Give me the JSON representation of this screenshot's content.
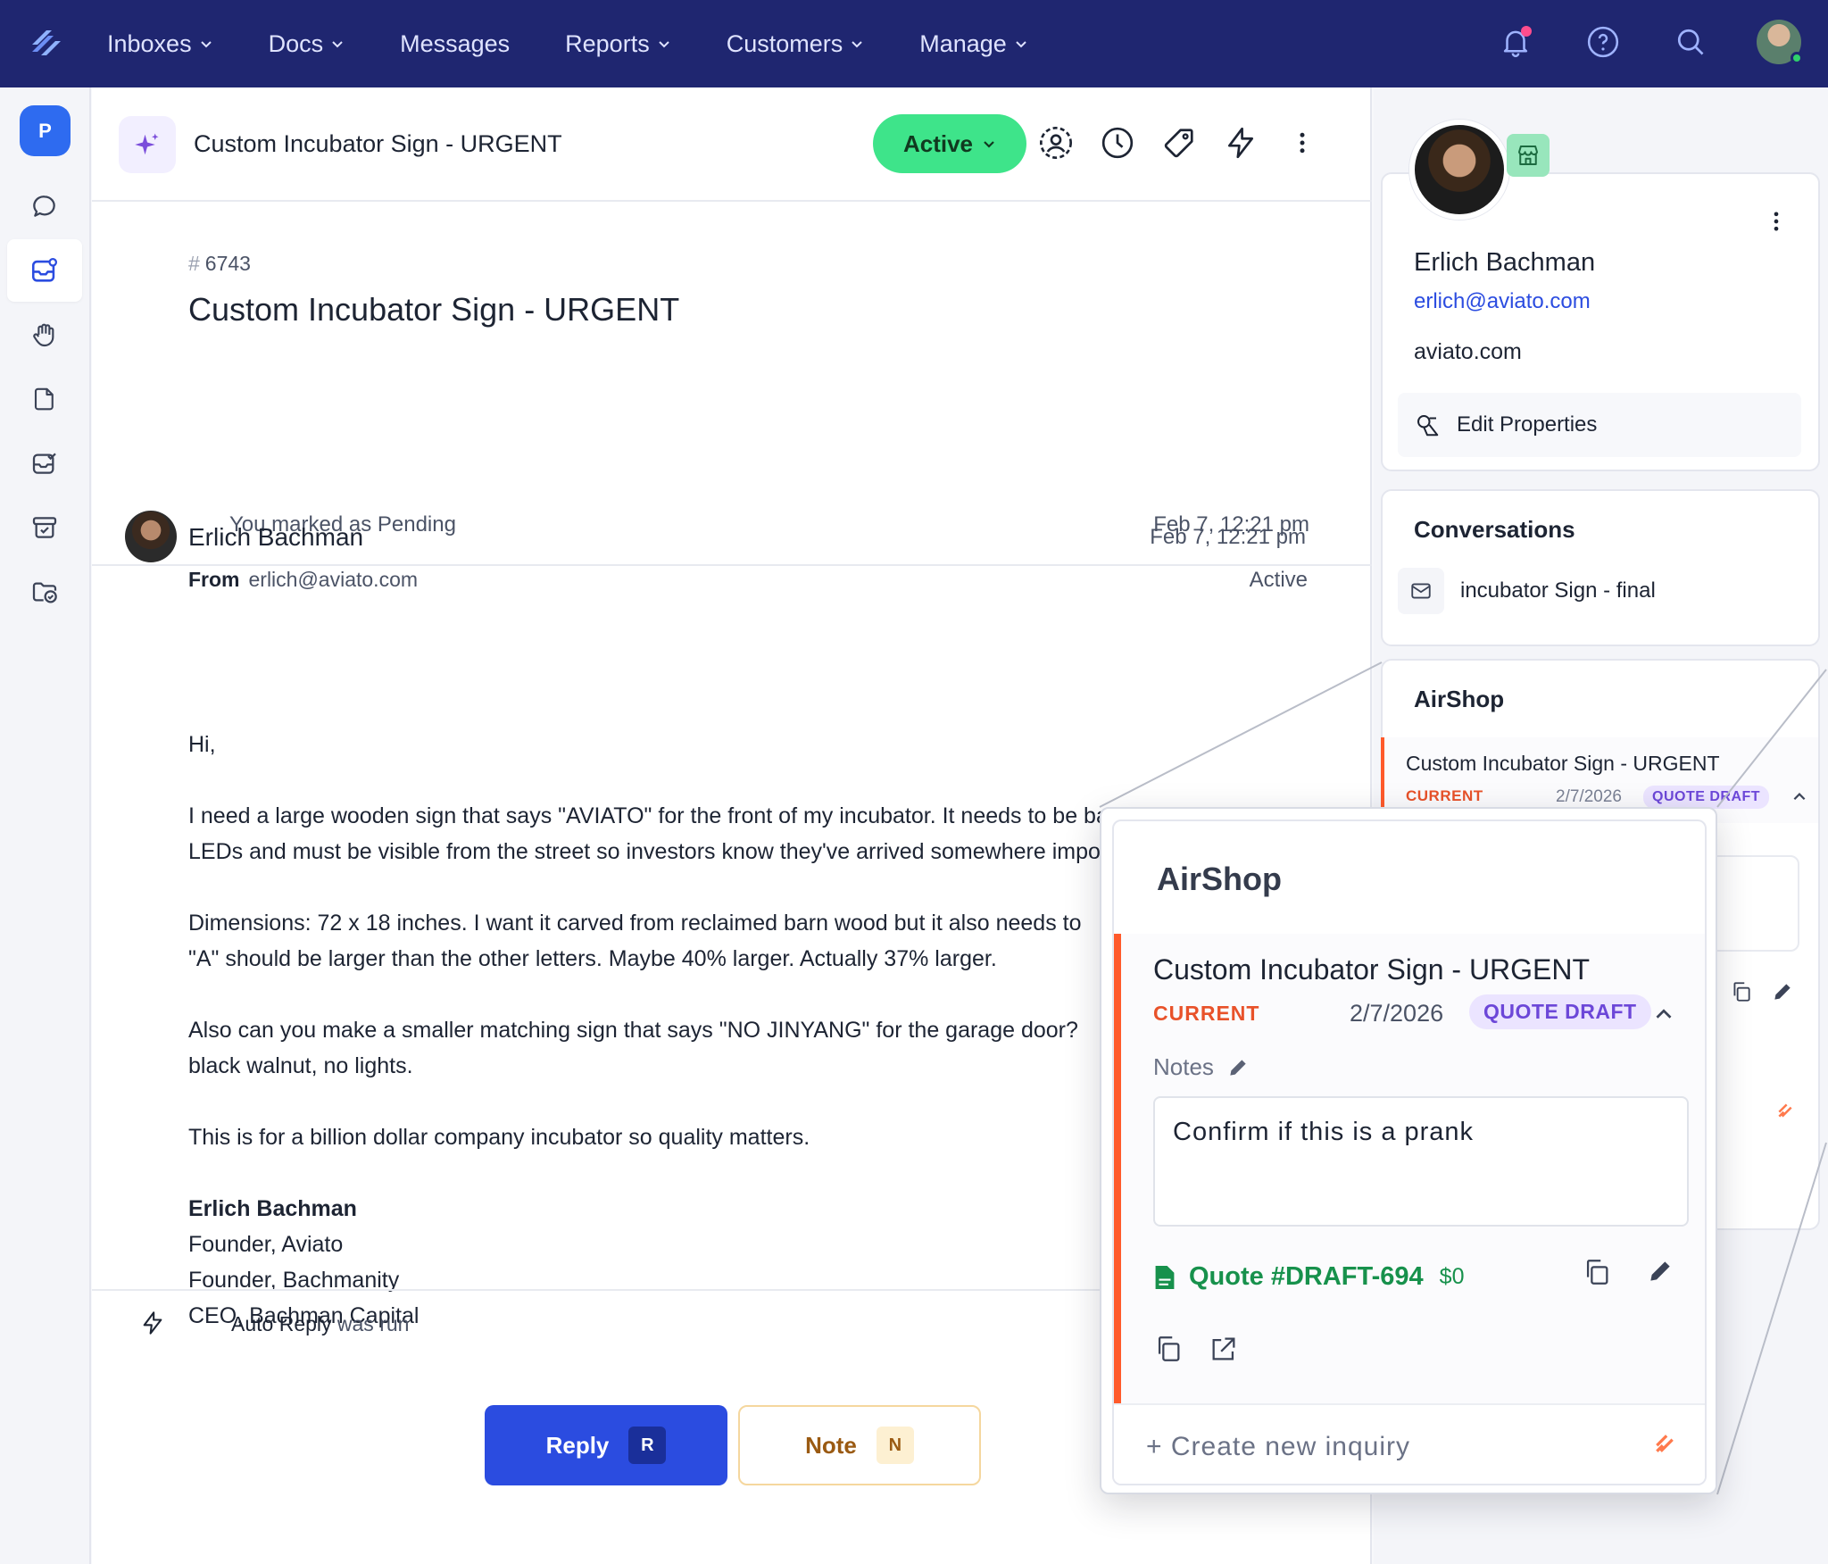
{
  "topnav": {
    "items": [
      {
        "label": "Inboxes",
        "has_dropdown": true
      },
      {
        "label": "Docs",
        "has_dropdown": true
      },
      {
        "label": "Messages",
        "has_dropdown": false
      },
      {
        "label": "Reports",
        "has_dropdown": true
      },
      {
        "label": "Customers",
        "has_dropdown": true
      },
      {
        "label": "Manage",
        "has_dropdown": true
      }
    ],
    "icons": [
      "bell-icon",
      "help-icon",
      "search-icon",
      "user-avatar"
    ],
    "colors": {
      "bg": "#1f2670",
      "notification_dot": "#ff4d8d"
    }
  },
  "leftbar": {
    "badge": "P",
    "items": [
      "chat-icon",
      "inbox-icon",
      "hand-icon",
      "doc-icon",
      "mailbox-check-icon",
      "archive-icon",
      "folder-check-icon"
    ],
    "active_index": 1
  },
  "conversation": {
    "header_title": "Custom Incubator Sign - URGENT",
    "status": "Active",
    "status_color": "#3ee48a",
    "number": "6743",
    "title": "Custom Incubator Sign - URGENT",
    "event": {
      "text": "You marked as Pending",
      "time": "Feb 7, 12:21 pm"
    },
    "message": {
      "sender": "Erlich Bachman",
      "time": "Feb 7, 12:21 pm",
      "from_label": "From",
      "from_email": "erlich@aviato.com",
      "status": "Active",
      "paragraphs": [
        "Hi,",
        "I need a large wooden sign that says \"AVIATO\" for the front of my incubator. It needs to be backlit with RGB\nLEDs and must be visible from the street so investors know they've arrived somewhere important.",
        "Dimensions: 72 x 18 inches. I want it carved from reclaimed barn wood but it also needs to\n\"A\" should be larger than the other letters. Maybe 40% larger. Actually 37% larger.",
        "Also can you make a smaller matching sign that says \"NO JINYANG\" for the garage door?\nblack walnut, no lights.",
        "This is for a billion dollar company incubator so quality matters."
      ],
      "signature": {
        "name": "Erlich Bachman",
        "lines": [
          "Founder, Aviato",
          "Founder, Bachmanity",
          "CEO, Bachman Capital"
        ]
      }
    },
    "auto_reply": {
      "bold": "Auto Reply",
      "rest": "was run"
    },
    "reply_button": {
      "label": "Reply",
      "key": "R"
    },
    "note_button": {
      "label": "Note",
      "key": "N"
    }
  },
  "sidebar": {
    "profile": {
      "name": "Erlich Bachman",
      "email": "erlich@aviato.com",
      "domain": "aviato.com",
      "edit_label": "Edit Properties"
    },
    "conversations": {
      "title": "Conversations",
      "items": [
        "incubator Sign - final"
      ]
    },
    "airshop": {
      "title": "AirShop",
      "item_title": "Custom Incubator Sign - URGENT",
      "current": "CURRENT",
      "date": "2/7/2026",
      "status": "QUOTE DRAFT"
    }
  },
  "zoom_panel": {
    "title": "AirShop",
    "item_title": "Custom Incubator Sign - URGENT",
    "current": "CURRENT",
    "date": "2/7/2026",
    "status": "QUOTE DRAFT",
    "notes_label": "Notes",
    "notes_value": "Confirm if this is a prank",
    "quote_label": "Quote #DRAFT-694",
    "quote_amount": "$0",
    "create_label": "+ Create new inquiry",
    "accent_color": "#ff5a2b"
  }
}
